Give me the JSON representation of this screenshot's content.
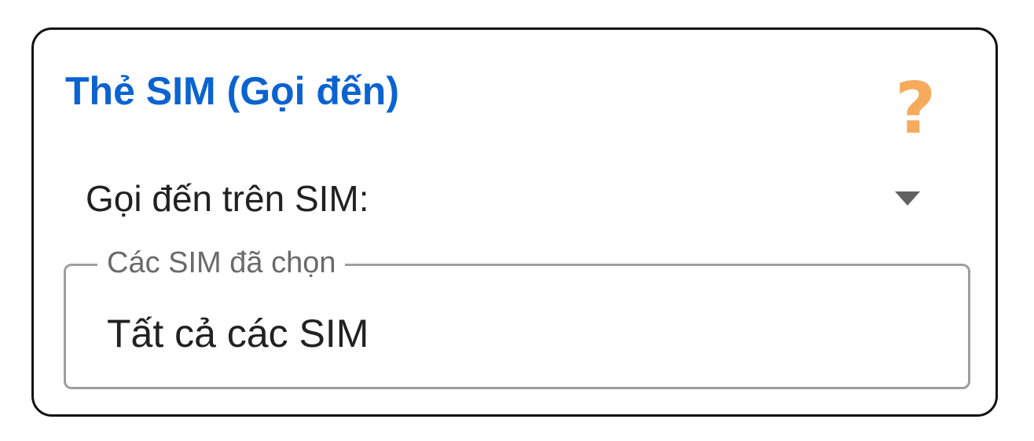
{
  "card": {
    "title": "Thẻ SIM (Gọi đến)",
    "help_icon": "?"
  },
  "selector": {
    "label": "Gọi đến trên SIM:",
    "arrow_icon": "dropdown-arrow"
  },
  "sim_field": {
    "legend": "Các SIM đã chọn",
    "value": "Tất cả các SIM"
  },
  "colors": {
    "title": "#0b63d1",
    "help_icon": "#f6aa5c",
    "border": "#111111",
    "field_border": "#9e9e9e"
  }
}
